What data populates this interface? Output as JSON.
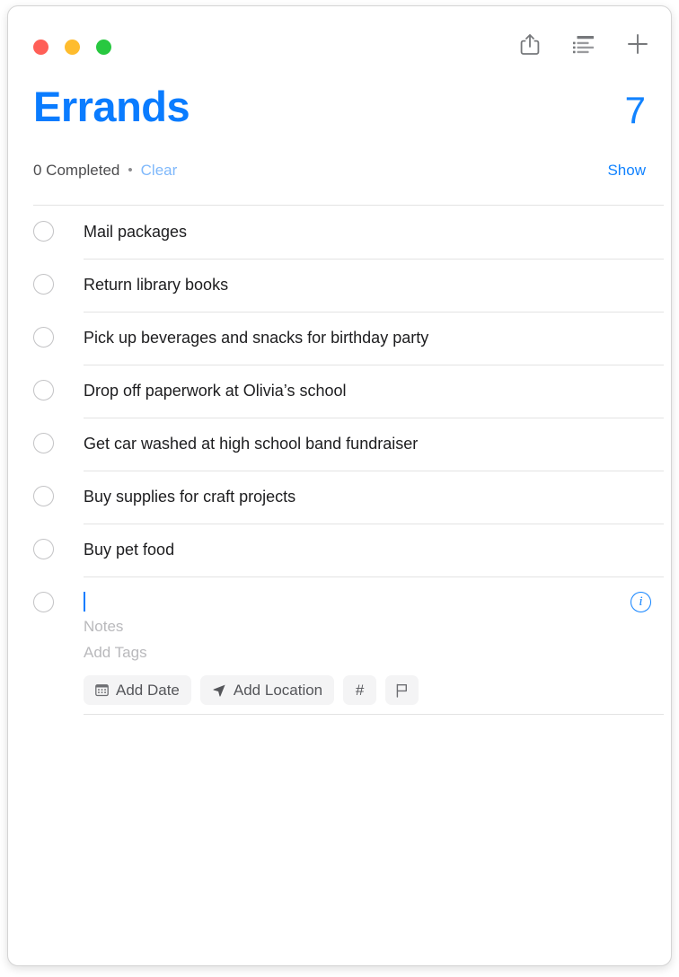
{
  "window": {
    "controls": [
      {
        "name": "close",
        "color": "#ff5f57",
        "label": "Close"
      },
      {
        "name": "minimize",
        "color": "#febc2e",
        "label": "Minimize"
      },
      {
        "name": "maximize",
        "color": "#28c840",
        "label": "Zoom"
      }
    ]
  },
  "toolbar": {
    "actions": [
      {
        "icon": "share-icon",
        "label": "Share"
      },
      {
        "icon": "list-options-icon",
        "label": "View Options"
      },
      {
        "icon": "plus-icon",
        "label": "Add Reminder"
      }
    ]
  },
  "header": {
    "title": "Errands",
    "count": "7",
    "title_color": "#0a7cff",
    "count_color": "#1283ff"
  },
  "meta": {
    "completed_text": "0 Completed",
    "separator": "•",
    "clear_label": "Clear",
    "clear_color": "#7fb8fb",
    "show_label": "Show",
    "show_color": "#1283ff"
  },
  "reminders": [
    {
      "title": "Mail packages",
      "completed": false
    },
    {
      "title": "Return library books",
      "completed": false
    },
    {
      "title": "Pick up beverages and snacks for birthday party",
      "completed": false
    },
    {
      "title": "Drop off paperwork at Olivia’s school",
      "completed": false
    },
    {
      "title": "Get car washed at high school band fundraiser",
      "completed": false
    },
    {
      "title": "Buy supplies for craft projects",
      "completed": false
    },
    {
      "title": "Buy pet food",
      "completed": false
    }
  ],
  "new_reminder": {
    "title_value": "",
    "notes_placeholder": "Notes",
    "tags_placeholder": "Add Tags",
    "caret_color": "#0a7cff",
    "quick_actions": [
      {
        "icon": "calendar-icon",
        "label": "Add Date"
      },
      {
        "icon": "location-arrow-icon",
        "label": "Add Location"
      },
      {
        "icon": "hashtag-icon",
        "label": "#"
      },
      {
        "icon": "flag-icon",
        "label": ""
      }
    ],
    "info_label": "i"
  }
}
